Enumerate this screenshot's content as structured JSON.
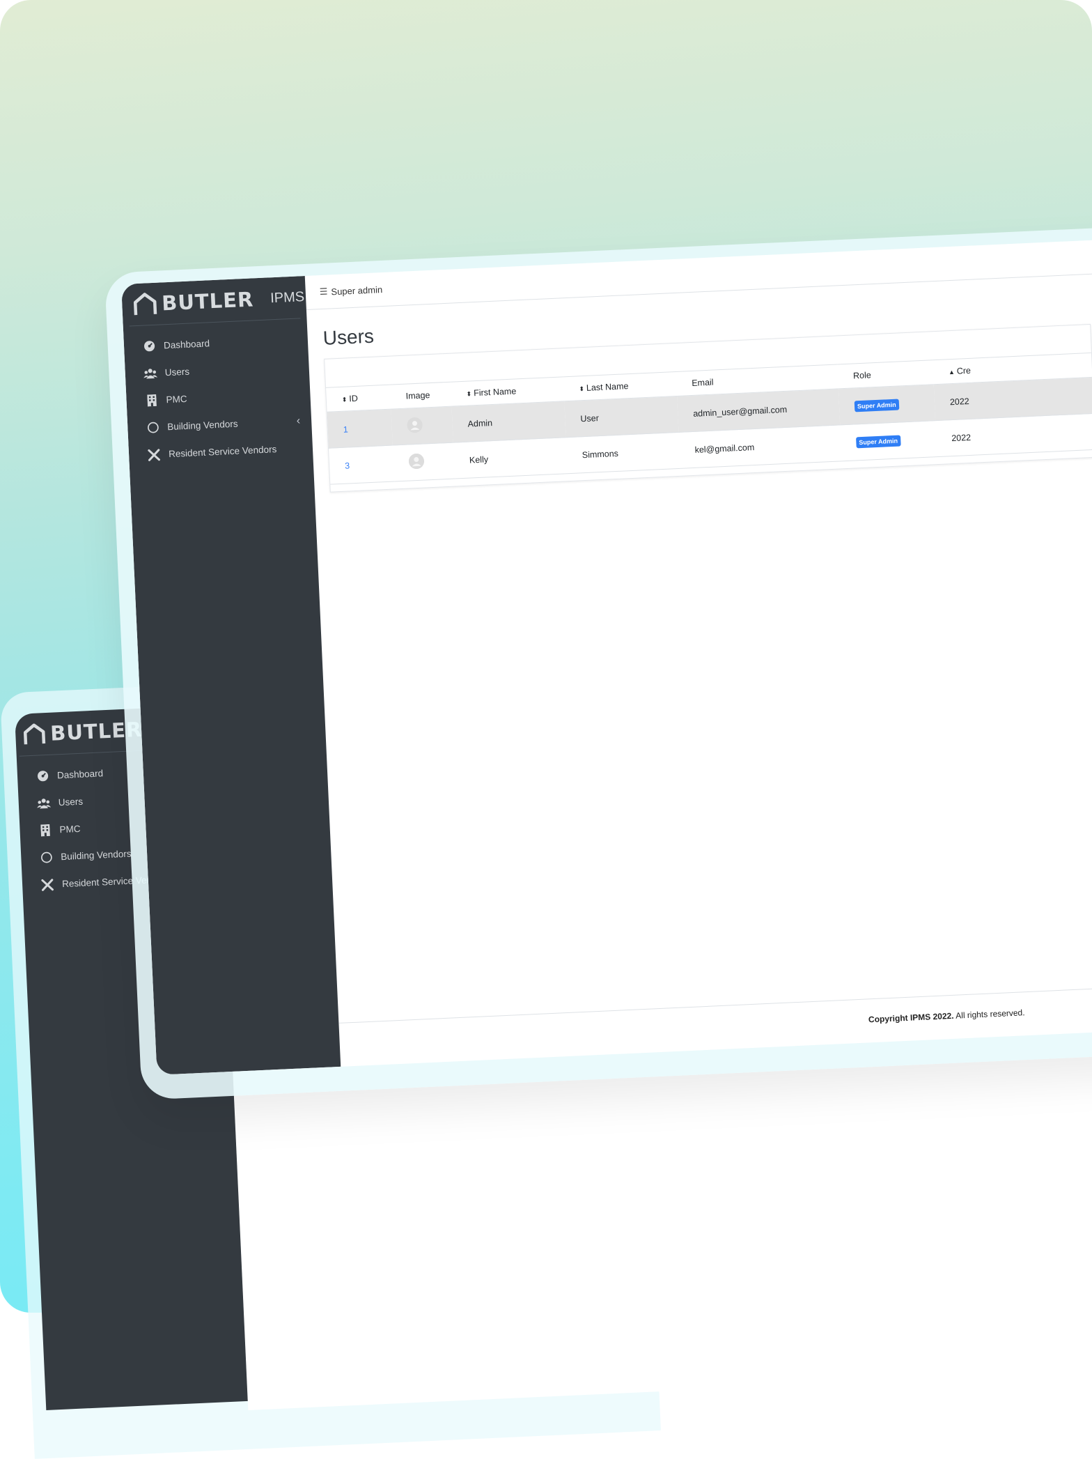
{
  "app": {
    "brand": "BUTLER",
    "brand_sub": "IPMS",
    "topbar_label": "Super admin",
    "page_title": "Users"
  },
  "sidebar": {
    "items": [
      {
        "label": "Dashboard",
        "icon": "dashboard-icon"
      },
      {
        "label": "Users",
        "icon": "users-icon"
      },
      {
        "label": "PMC",
        "icon": "building-icon"
      },
      {
        "label": "Building Vendors",
        "icon": "circle-icon"
      },
      {
        "label": "Resident Service Vendors",
        "icon": "tools-icon"
      }
    ]
  },
  "table": {
    "headers": [
      "ID",
      "Image",
      "First Name",
      "Last Name",
      "Email",
      "Role",
      "Cre"
    ],
    "rows": [
      {
        "id": "1",
        "first": "Admin",
        "last": "User",
        "email": "admin_user@gmail.com",
        "role": "Super Admin",
        "created": "2022"
      },
      {
        "id": "3",
        "first": "Kelly",
        "last": "Simmons",
        "email": "kel@gmail.com",
        "role": "Super Admin",
        "created": "2022"
      }
    ]
  },
  "footer": {
    "copyright_bold": "Copyright IPMS 2022.",
    "copyright_rest": " All rights reserved."
  },
  "colors": {
    "sidebar": "#343a40",
    "badge": "#2f7ef5",
    "link": "#3b82f6"
  }
}
